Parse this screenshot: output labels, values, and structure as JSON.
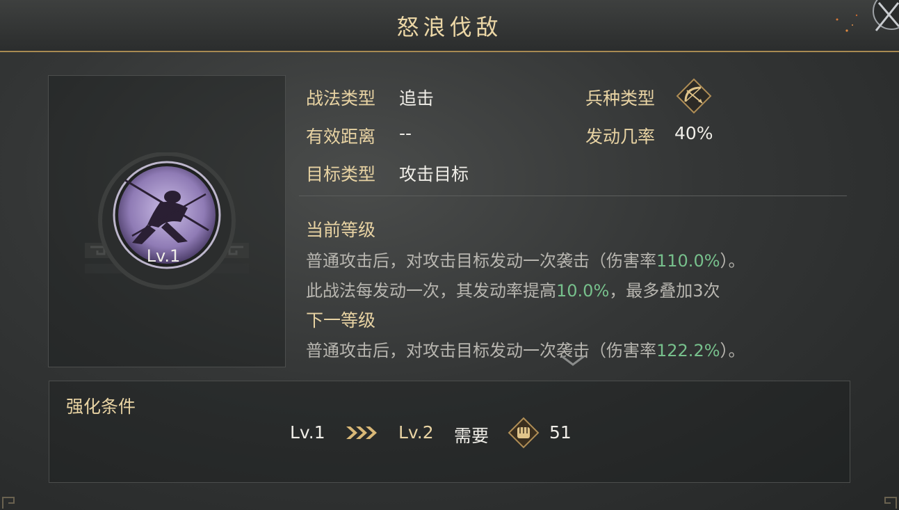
{
  "window": {
    "title": "怒浪伐敌"
  },
  "skill": {
    "level_badge": "Lv.1",
    "icon": "warrior-silhouette-icon"
  },
  "properties": {
    "tactic_type": {
      "label": "战法类型",
      "value": "追击"
    },
    "effective_range": {
      "label": "有效距离",
      "value": "--"
    },
    "target_type": {
      "label": "目标类型",
      "value": "攻击目标"
    },
    "troop_type": {
      "label": "兵种类型",
      "icon": "bow-archer-icon"
    },
    "trigger_rate": {
      "label": "发动几率",
      "value": "40%"
    }
  },
  "current_level": {
    "heading": "当前等级",
    "line1": {
      "pre": "普通攻击后，对攻击目标发动一次袭击（伤害率",
      "highlight": "110.0%",
      "post": "）。"
    },
    "line2": {
      "pre": "此战法每发动一次，其发动率提高",
      "highlight": "10.0%",
      "post": "，最多叠加3次"
    }
  },
  "next_level": {
    "heading": "下一等级",
    "line1": {
      "pre": "普通攻击后，对攻击目标发动一次袭击（伤害率",
      "highlight": "122.2%",
      "post": "）。"
    }
  },
  "enhance": {
    "title": "强化条件",
    "from_level": "Lv.1",
    "to_level": "Lv.2",
    "need_label": "需要",
    "cost": "51",
    "cost_icon": "fist-token-icon",
    "arrow_icon": "triple-chevron-right-icon"
  },
  "colors": {
    "accent_gold": "#e8d3a3",
    "highlight_green": "#77c08c",
    "title_gold": "#ecd7a6"
  }
}
